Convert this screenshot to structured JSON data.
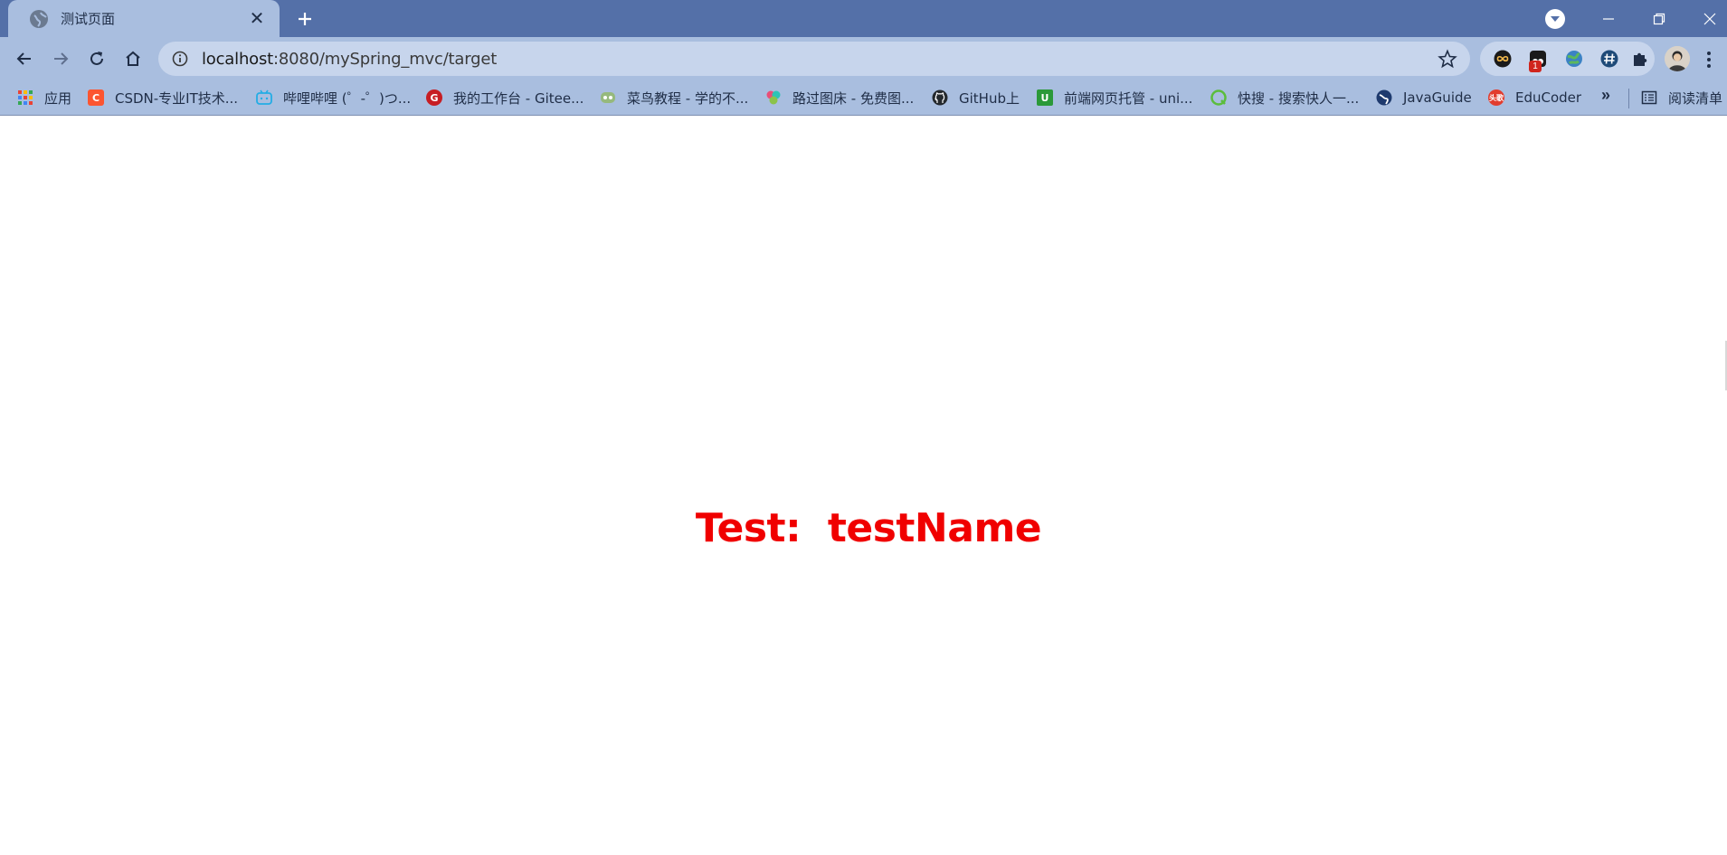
{
  "browser": {
    "tab": {
      "title": "测试页面",
      "close_glyph": "✕"
    },
    "new_tab_glyph": "+",
    "address": {
      "host": "localhost",
      "rest": ":8080/mySpring_mvc/target"
    },
    "extensions": [
      {
        "name": "infinity-extension-icon",
        "color": "#1a1a1a"
      },
      {
        "name": "tampermonkey-extension-icon",
        "color": "#1a1a1a",
        "badge": "1"
      },
      {
        "name": "globe-extension-icon",
        "color": "#3a8d3a"
      },
      {
        "name": "hash-extension-icon",
        "color": "#1e4a78"
      },
      {
        "name": "puzzle-extensions-icon",
        "color": "#1f2d46"
      }
    ],
    "colors": {
      "tabstrip": "#5470a8",
      "toolbar": "#a9bedf",
      "omnibox": "#c7d5ec"
    }
  },
  "bookmarks": {
    "items": [
      {
        "label": "应用",
        "icon": "apps-grid-icon",
        "color": "#e94235"
      },
      {
        "label": "CSDN-专业IT技术...",
        "icon": "csdn-icon",
        "color": "#fc5531",
        "glyph": "C"
      },
      {
        "label": "哔哩哔哩 (゜-゜)つ...",
        "icon": "bilibili-icon",
        "color": "#23ade5"
      },
      {
        "label": "我的工作台 - Gitee...",
        "icon": "gitee-icon",
        "color": "#c71d23",
        "glyph": "G"
      },
      {
        "label": "菜鸟教程 - 学的不...",
        "icon": "runoob-icon",
        "color": "#96b97d"
      },
      {
        "label": "路过图床 - 免费图...",
        "icon": "imgchr-icon",
        "color": "#e94e77"
      },
      {
        "label": "GitHub上",
        "icon": "github-icon",
        "color": "#24292e"
      },
      {
        "label": "前端网页托管 - uni...",
        "icon": "unicloud-icon",
        "color": "#2b9939",
        "glyph": "U"
      },
      {
        "label": "快搜 - 搜索快人一...",
        "icon": "kuaisou-icon",
        "color": "#5bbd3c"
      },
      {
        "label": "JavaGuide",
        "icon": "javaguide-icon",
        "color": "#1e3a6e"
      },
      {
        "label": "EduCoder",
        "icon": "educoder-icon",
        "color": "#e23c2e",
        "glyph": "头歌"
      }
    ],
    "more_glyph": "»",
    "reading_list": "阅读清单"
  },
  "page": {
    "heading_label": "Test:",
    "heading_value": "testName",
    "heading_color": "#f00000"
  }
}
